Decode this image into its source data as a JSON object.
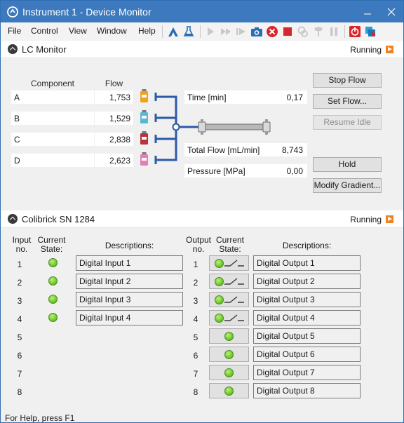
{
  "window": {
    "title": "Instrument 1 - Device Monitor"
  },
  "menu": [
    "File",
    "Control",
    "View",
    "Window",
    "Help"
  ],
  "toolbar_icons": [
    "analysis-icon",
    "flask-icon",
    "play-icon",
    "fast-forward-icon",
    "step-forward-icon",
    "camera-icon",
    "stop-circle-icon",
    "stop-square-icon",
    "connect-icon",
    "lamp-icon",
    "pause-icon",
    "power-icon",
    "network-icon"
  ],
  "lc": {
    "title": "LC Monitor",
    "status": "Running",
    "header_component": "Component",
    "header_flow": "Flow",
    "components": [
      {
        "name": "A",
        "flow": "1,753",
        "color": "#f1a21b"
      },
      {
        "name": "B",
        "flow": "1,529",
        "color": "#56b8d2"
      },
      {
        "name": "C",
        "flow": "2,838",
        "color": "#b8333a"
      },
      {
        "name": "D",
        "flow": "2,623",
        "color": "#e47fb6"
      }
    ],
    "time_label": "Time [min]",
    "time_value": "0,17",
    "total_flow_label": "Total Flow [mL/min]",
    "total_flow_value": "8,743",
    "pressure_label": "Pressure [MPa]",
    "pressure_value": "0,00",
    "buttons": {
      "stop_flow": "Stop Flow",
      "set_flow": "Set Flow...",
      "resume_idle": "Resume Idle",
      "hold": "Hold",
      "modify_gradient": "Modify Gradient..."
    }
  },
  "colibrick": {
    "title": "Colibrick SN 1284",
    "status": "Running",
    "input_header": "Input no.",
    "state_header": "Current State:",
    "desc_header": "Descriptions:",
    "output_header": "Output no.",
    "inputs": [
      {
        "no": "1",
        "desc": "Digital Input 1"
      },
      {
        "no": "2",
        "desc": "Digital Input 2"
      },
      {
        "no": "3",
        "desc": "Digital Input 3"
      },
      {
        "no": "4",
        "desc": "Digital Input 4"
      },
      {
        "no": "5"
      },
      {
        "no": "6"
      },
      {
        "no": "7"
      },
      {
        "no": "8"
      }
    ],
    "outputs": [
      {
        "no": "1",
        "desc": "Digital Output 1",
        "switch": true
      },
      {
        "no": "2",
        "desc": "Digital Output 2",
        "switch": true
      },
      {
        "no": "3",
        "desc": "Digital Output 3",
        "switch": true
      },
      {
        "no": "4",
        "desc": "Digital Output 4",
        "switch": true
      },
      {
        "no": "5",
        "desc": "Digital Output 5",
        "switch": false
      },
      {
        "no": "6",
        "desc": "Digital Output 6",
        "switch": false
      },
      {
        "no": "7",
        "desc": "Digital Output 7",
        "switch": false
      },
      {
        "no": "8",
        "desc": "Digital Output 8",
        "switch": false
      }
    ]
  },
  "statusbar": "For Help, press F1"
}
